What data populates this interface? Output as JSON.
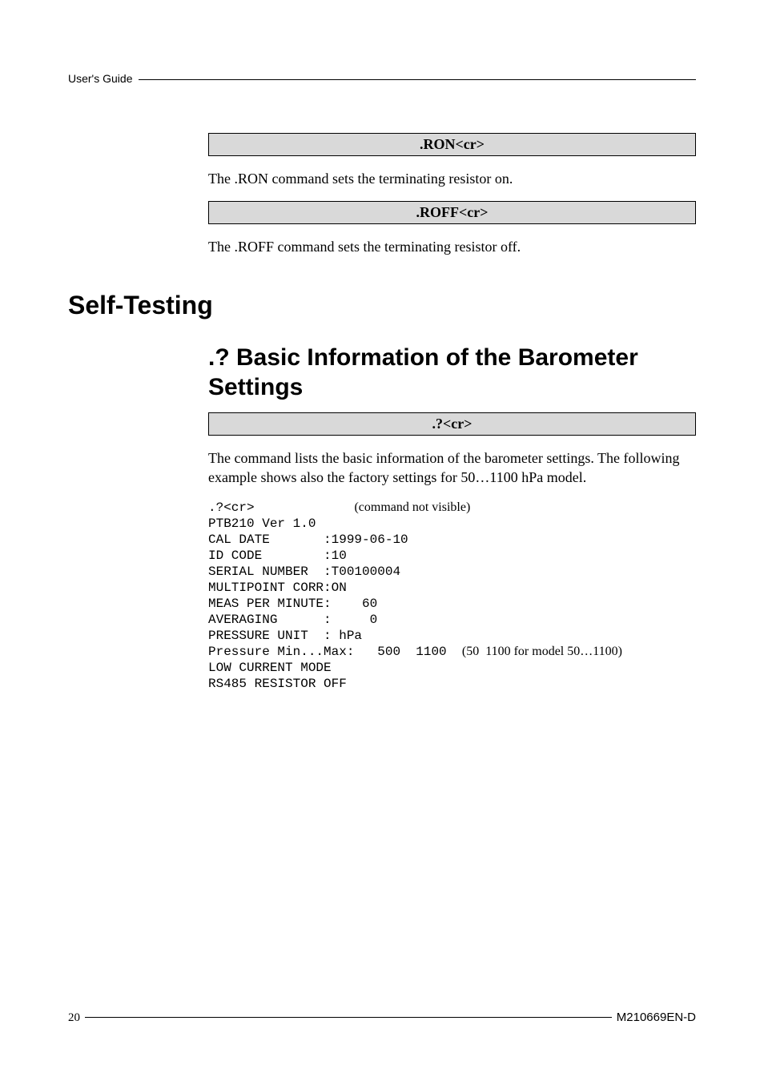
{
  "header": {
    "label": "User's Guide"
  },
  "box1": {
    "text": ".RON<cr>"
  },
  "para1": "The .RON command sets the terminating resistor on.",
  "box2": {
    "text": ".ROFF<cr>"
  },
  "para2": "The .ROFF command sets the terminating resistor off.",
  "section_title": "Self-Testing",
  "subsection_title": ".? Basic Information of the Barometer Settings",
  "box3": {
    "text": ".?<cr>"
  },
  "para3": "The command lists the basic information of the barometer settings. The following example shows also the factory settings for 50…1100 hPa model.",
  "code": {
    "line1_cmd": ".?<cr>",
    "line1_note": "(command not visible)",
    "line2": "PTB210 Ver 1.0",
    "line3": "CAL DATE       :1999-06-10",
    "line4": "ID CODE        :10",
    "line5": "SERIAL NUMBER  :T00100004",
    "line6": "MULTIPOINT CORR:ON",
    "line7": "MEAS PER MINUTE:    60",
    "line8": "AVERAGING      :     0",
    "line9": "PRESSURE UNIT  : hPa",
    "line10_a": "Pressure Min...Max:   500  1100  ",
    "line10_note": "(50  1100 for model 50…1100)",
    "line11": "LOW CURRENT MODE",
    "line12": "RS485 RESISTOR OFF"
  },
  "footer": {
    "page": "20",
    "doc": "M210669EN-D"
  }
}
